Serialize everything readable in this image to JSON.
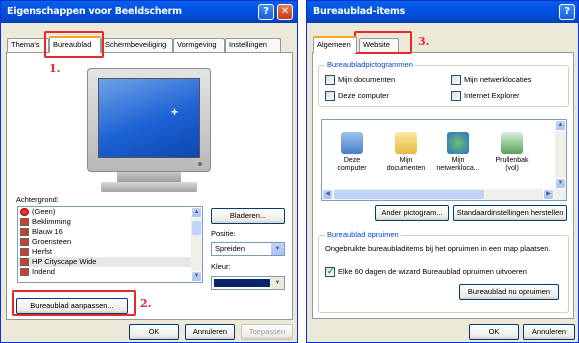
{
  "window1": {
    "title": "Eigenschappen voor Beeldscherm",
    "tabs": [
      "Thema's",
      "Bureaublad",
      "Schermbeveiliging",
      "Vormgeving",
      "Instellingen"
    ],
    "background_label": "Achtergrond:",
    "backgrounds": [
      "(Geen)",
      "Beklimming",
      "Blauw 16",
      "Groensteen",
      "Herfst",
      "HP Cityscape Wide",
      "Indend"
    ],
    "selected_background": "HP Cityscape Wide",
    "browse_button": "Bladeren...",
    "position_label": "Positie:",
    "position_value": "Spreiden",
    "color_label": "Kleur:",
    "customize_button": "Bureaublad aanpassen...",
    "ok": "OK",
    "cancel": "Annuleren",
    "apply": "Toepassen",
    "annotation_1": "1.",
    "annotation_2": "2."
  },
  "window2": {
    "title": "Bureaublad-items",
    "tabs": [
      "Algemeen",
      "Website"
    ],
    "annotation_3": "3.",
    "icons_group": "Bureaubladpictogrammen",
    "checkboxes": [
      {
        "label": "Mijn documenten",
        "checked": false
      },
      {
        "label": "Mijn netwerklocaties",
        "checked": false
      },
      {
        "label": "Deze computer",
        "checked": false
      },
      {
        "label": "Internet Explorer",
        "checked": false
      }
    ],
    "icons": [
      {
        "l1": "Deze",
        "l2": "computer",
        "name": "computer-icon"
      },
      {
        "l1": "Mijn",
        "l2": "documenten",
        "name": "documents-icon"
      },
      {
        "l1": "Mijn",
        "l2": "netwerkloca...",
        "name": "network-icon"
      },
      {
        "l1": "Prullenbak",
        "l2": "(vol)",
        "name": "recycle-bin-icon"
      }
    ],
    "change_icon_button": "Ander pictogram...",
    "restore_default_button": "Standaardinstellingen herstellen",
    "cleanup_group": "Bureaublad opruimen",
    "cleanup_text": "Ongebruikte bureaubladitems bij het opruimen in een map plaatsen.",
    "cleanup_checkbox": "Elke 60 dagen de wizard Bureaublad opruimen uitvoeren",
    "cleanup_now_button": "Bureaublad nu opruimen",
    "ok": "OK",
    "cancel": "Annuleren"
  },
  "colors": {
    "annotation": "#e8282c",
    "titlebar": "#0054e3",
    "selection": "#316ac5"
  }
}
